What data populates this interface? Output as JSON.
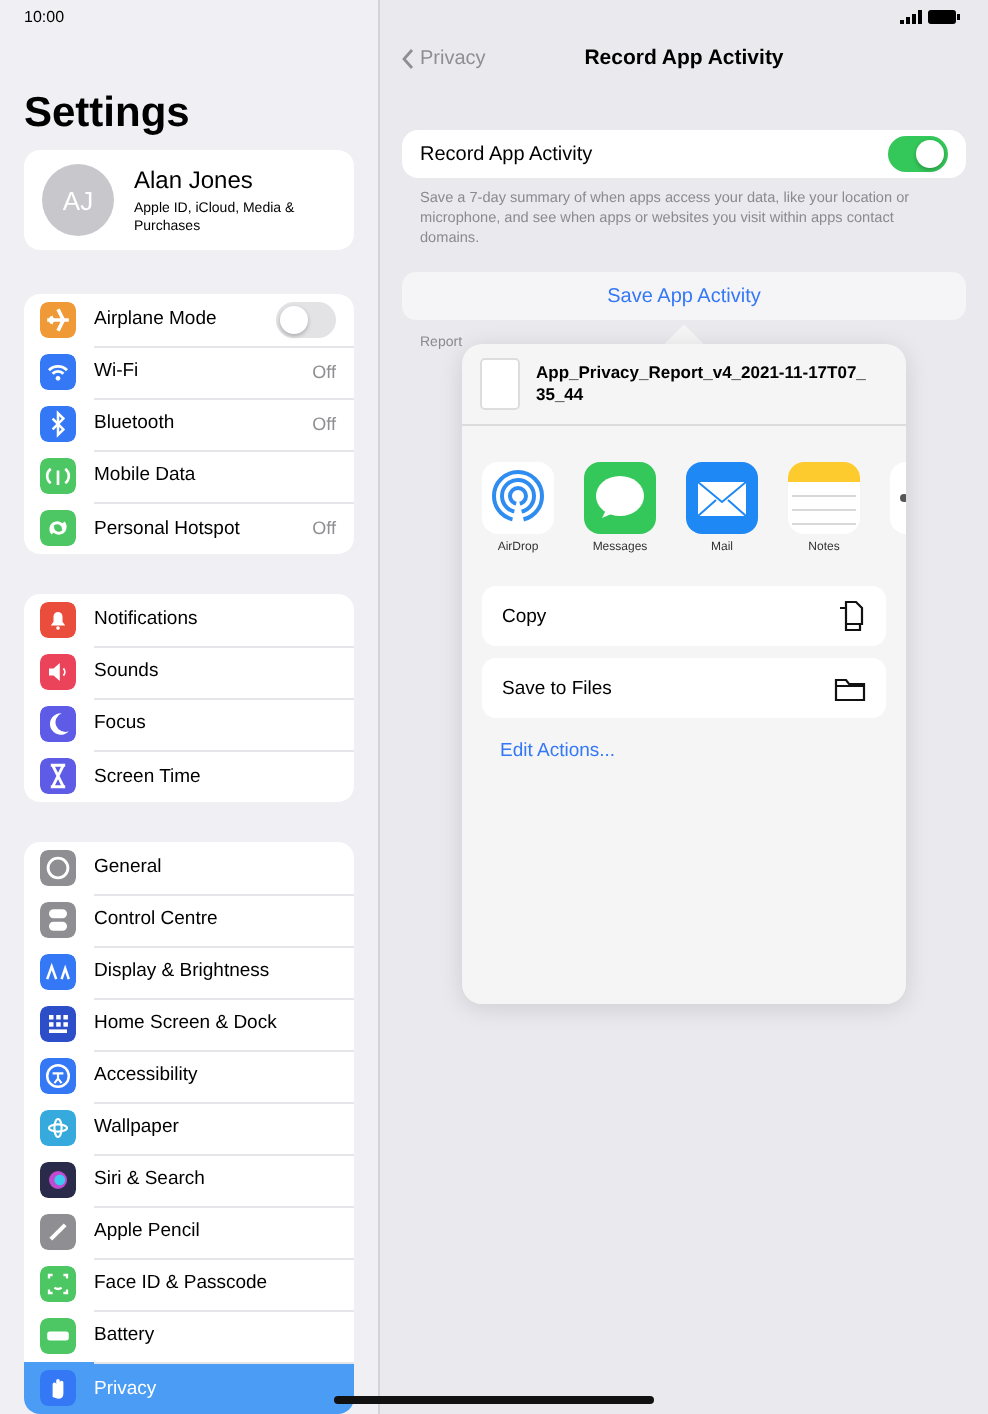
{
  "status_bar": {
    "time": "10:00"
  },
  "sidebar": {
    "title": "Settings",
    "profile": {
      "initials": "AJ",
      "name": "Alan Jones",
      "subtitle": "Apple ID, iCloud, Media & Purchases"
    },
    "groups": [
      [
        {
          "label": "Airplane Mode",
          "kind": "toggle",
          "on": false,
          "color": "#f09a37",
          "selected": false
        },
        {
          "label": "Wi-Fi",
          "kind": "value",
          "value": "Off",
          "color": "#3478f6",
          "selected": false
        },
        {
          "label": "Bluetooth",
          "kind": "value",
          "value": "Off",
          "color": "#3478f6",
          "selected": false
        },
        {
          "label": "Mobile Data",
          "kind": "plain",
          "color": "#4cc764",
          "selected": false
        },
        {
          "label": "Personal Hotspot",
          "kind": "value",
          "value": "Off",
          "color": "#4cc764",
          "selected": false
        }
      ],
      [
        {
          "label": "Notifications",
          "kind": "plain",
          "color": "#eb4d3d",
          "selected": false
        },
        {
          "label": "Sounds",
          "kind": "plain",
          "color": "#eb445a",
          "selected": false
        },
        {
          "label": "Focus",
          "kind": "plain",
          "color": "#5e5ce6",
          "selected": false
        },
        {
          "label": "Screen Time",
          "kind": "plain",
          "color": "#5e5ce6",
          "selected": false
        }
      ],
      [
        {
          "label": "General",
          "kind": "plain",
          "color": "#8e8e93",
          "selected": false
        },
        {
          "label": "Control Centre",
          "kind": "plain",
          "color": "#8e8e93",
          "selected": false
        },
        {
          "label": "Display & Brightness",
          "kind": "plain",
          "color": "#3478f6",
          "selected": false
        },
        {
          "label": "Home Screen & Dock",
          "kind": "plain",
          "color": "#2c4fc9",
          "selected": false
        },
        {
          "label": "Accessibility",
          "kind": "plain",
          "color": "#3478f6",
          "selected": false
        },
        {
          "label": "Wallpaper",
          "kind": "plain",
          "color": "#36aadc",
          "selected": false
        },
        {
          "label": "Siri & Search",
          "kind": "plain",
          "color": "#2a2a4a",
          "selected": false
        },
        {
          "label": "Apple Pencil",
          "kind": "plain",
          "color": "#8e8e93",
          "selected": false
        },
        {
          "label": "Face ID & Passcode",
          "kind": "plain",
          "color": "#4cc764",
          "selected": false
        },
        {
          "label": "Battery",
          "kind": "plain",
          "color": "#4cc764",
          "selected": false
        },
        {
          "label": "Privacy",
          "kind": "plain",
          "color": "#3478f6",
          "selected": true
        }
      ]
    ]
  },
  "detail": {
    "back": "Privacy",
    "title": "Record App Activity",
    "setting": {
      "label": "Record App Activity",
      "on": true
    },
    "footnote": "Save a 7-day summary of when apps access your data, like your location or microphone, and see when apps or websites you visit within apps contact domains.",
    "save_button": "Save App Activity",
    "report_note": "Report"
  },
  "share_sheet": {
    "file_name": "App_Privacy_Report_v4_2021-11-17T07_35_44",
    "apps": [
      {
        "label": "AirDrop",
        "kind": "airdrop"
      },
      {
        "label": "Messages",
        "kind": "messages"
      },
      {
        "label": "Mail",
        "kind": "mail"
      },
      {
        "label": "Notes",
        "kind": "notes"
      },
      {
        "kind": "partial"
      }
    ],
    "actions": [
      {
        "label": "Copy",
        "kind": "copy"
      },
      {
        "label": "Save to Files",
        "kind": "folder"
      }
    ],
    "edit_actions": "Edit Actions..."
  }
}
